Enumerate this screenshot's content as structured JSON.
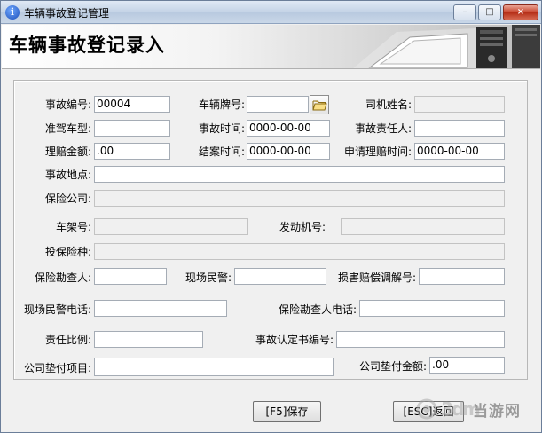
{
  "window": {
    "title": "车辆事故登记管理",
    "controls": {
      "minimize": "–",
      "maximize": "□",
      "close": "×"
    }
  },
  "banner": {
    "title": "车辆事故登记录入"
  },
  "form": {
    "accident_no": {
      "label": "事故编号:",
      "value": "00004"
    },
    "plate_no": {
      "label": "车辆牌号:",
      "value": ""
    },
    "driver_name": {
      "label": "司机姓名:",
      "value": ""
    },
    "license_type": {
      "label": "准驾车型:",
      "value": ""
    },
    "accident_time": {
      "label": "事故时间:",
      "value": "0000-00-00"
    },
    "responsible_person": {
      "label": "事故责任人:",
      "value": ""
    },
    "claim_amount": {
      "label": "理赔金额:",
      "value": ".00"
    },
    "close_time": {
      "label": "结案时间:",
      "value": "0000-00-00"
    },
    "claim_apply_time": {
      "label": "申请理赔时间:",
      "value": "0000-00-00"
    },
    "accident_place": {
      "label": "事故地点:",
      "value": ""
    },
    "insurer": {
      "label": "保险公司:",
      "value": ""
    },
    "frame_no": {
      "label": "车架号:",
      "value": ""
    },
    "engine_no": {
      "label": "发动机号:",
      "value": ""
    },
    "insurance_type": {
      "label": "投保险种:",
      "value": ""
    },
    "surveyor": {
      "label": "保险勘查人:",
      "value": ""
    },
    "police": {
      "label": "现场民警:",
      "value": ""
    },
    "mediation_no": {
      "label": "损害赔偿调解号:",
      "value": ""
    },
    "police_phone": {
      "label": "现场民警电话:",
      "value": ""
    },
    "surveyor_phone": {
      "label": "保险勘查人电话:",
      "value": ""
    },
    "liability_ratio": {
      "label": "责任比例:",
      "value": ""
    },
    "certificate_no": {
      "label": "事故认定书编号:",
      "value": ""
    },
    "advance_item": {
      "label": "公司垫付项目:",
      "value": ""
    },
    "advance_amount": {
      "label": "公司垫付金额:",
      "value": ".00"
    }
  },
  "buttons": {
    "save": "[F5]保存",
    "back": "[ESC]返回"
  },
  "icons": {
    "browse": "folder-open-icon",
    "app": "info-icon"
  },
  "watermark": {
    "text": "当游网"
  }
}
